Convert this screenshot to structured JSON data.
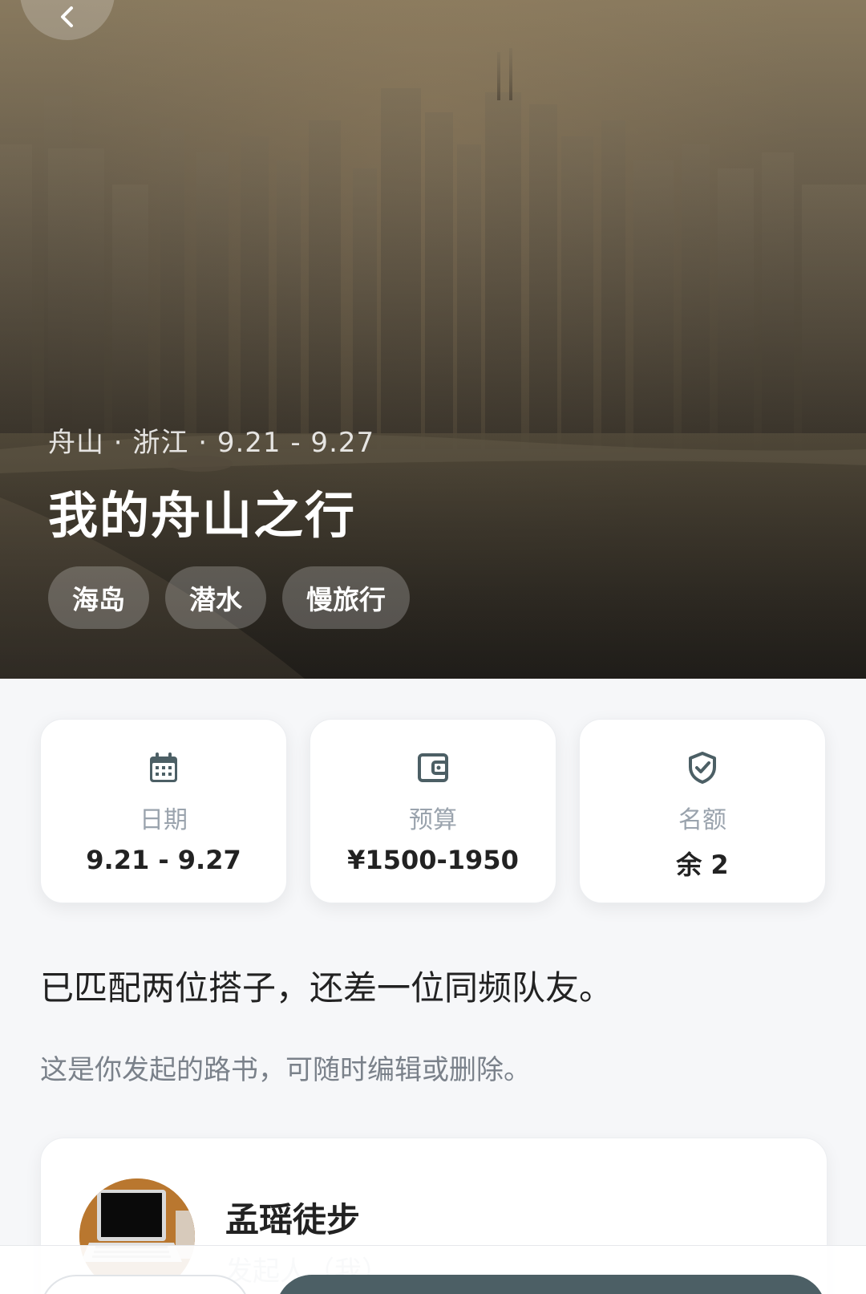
{
  "hero": {
    "meta": "舟山 · 浙江 · 9.21 - 9.27",
    "title": "我的舟山之行",
    "tags": [
      "海岛",
      "潜水",
      "慢旅行"
    ]
  },
  "info_cards": [
    {
      "icon": "calendar-icon",
      "label": "日期",
      "value": "9.21 - 9.27"
    },
    {
      "icon": "wallet-icon",
      "label": "预算",
      "value": "¥1500-1950"
    },
    {
      "icon": "shield-check-icon",
      "label": "名额",
      "value": "余 2"
    }
  ],
  "status_text": "已匹配两位搭子，还差一位同频队友。",
  "owner_note": "这是你发起的路书，可随时编辑或删除。",
  "organizer": {
    "name": "孟瑶徒步",
    "role": "发起人（我）"
  },
  "colors": {
    "primary_button": "#4c5f65",
    "icon": "#4c5f65"
  }
}
